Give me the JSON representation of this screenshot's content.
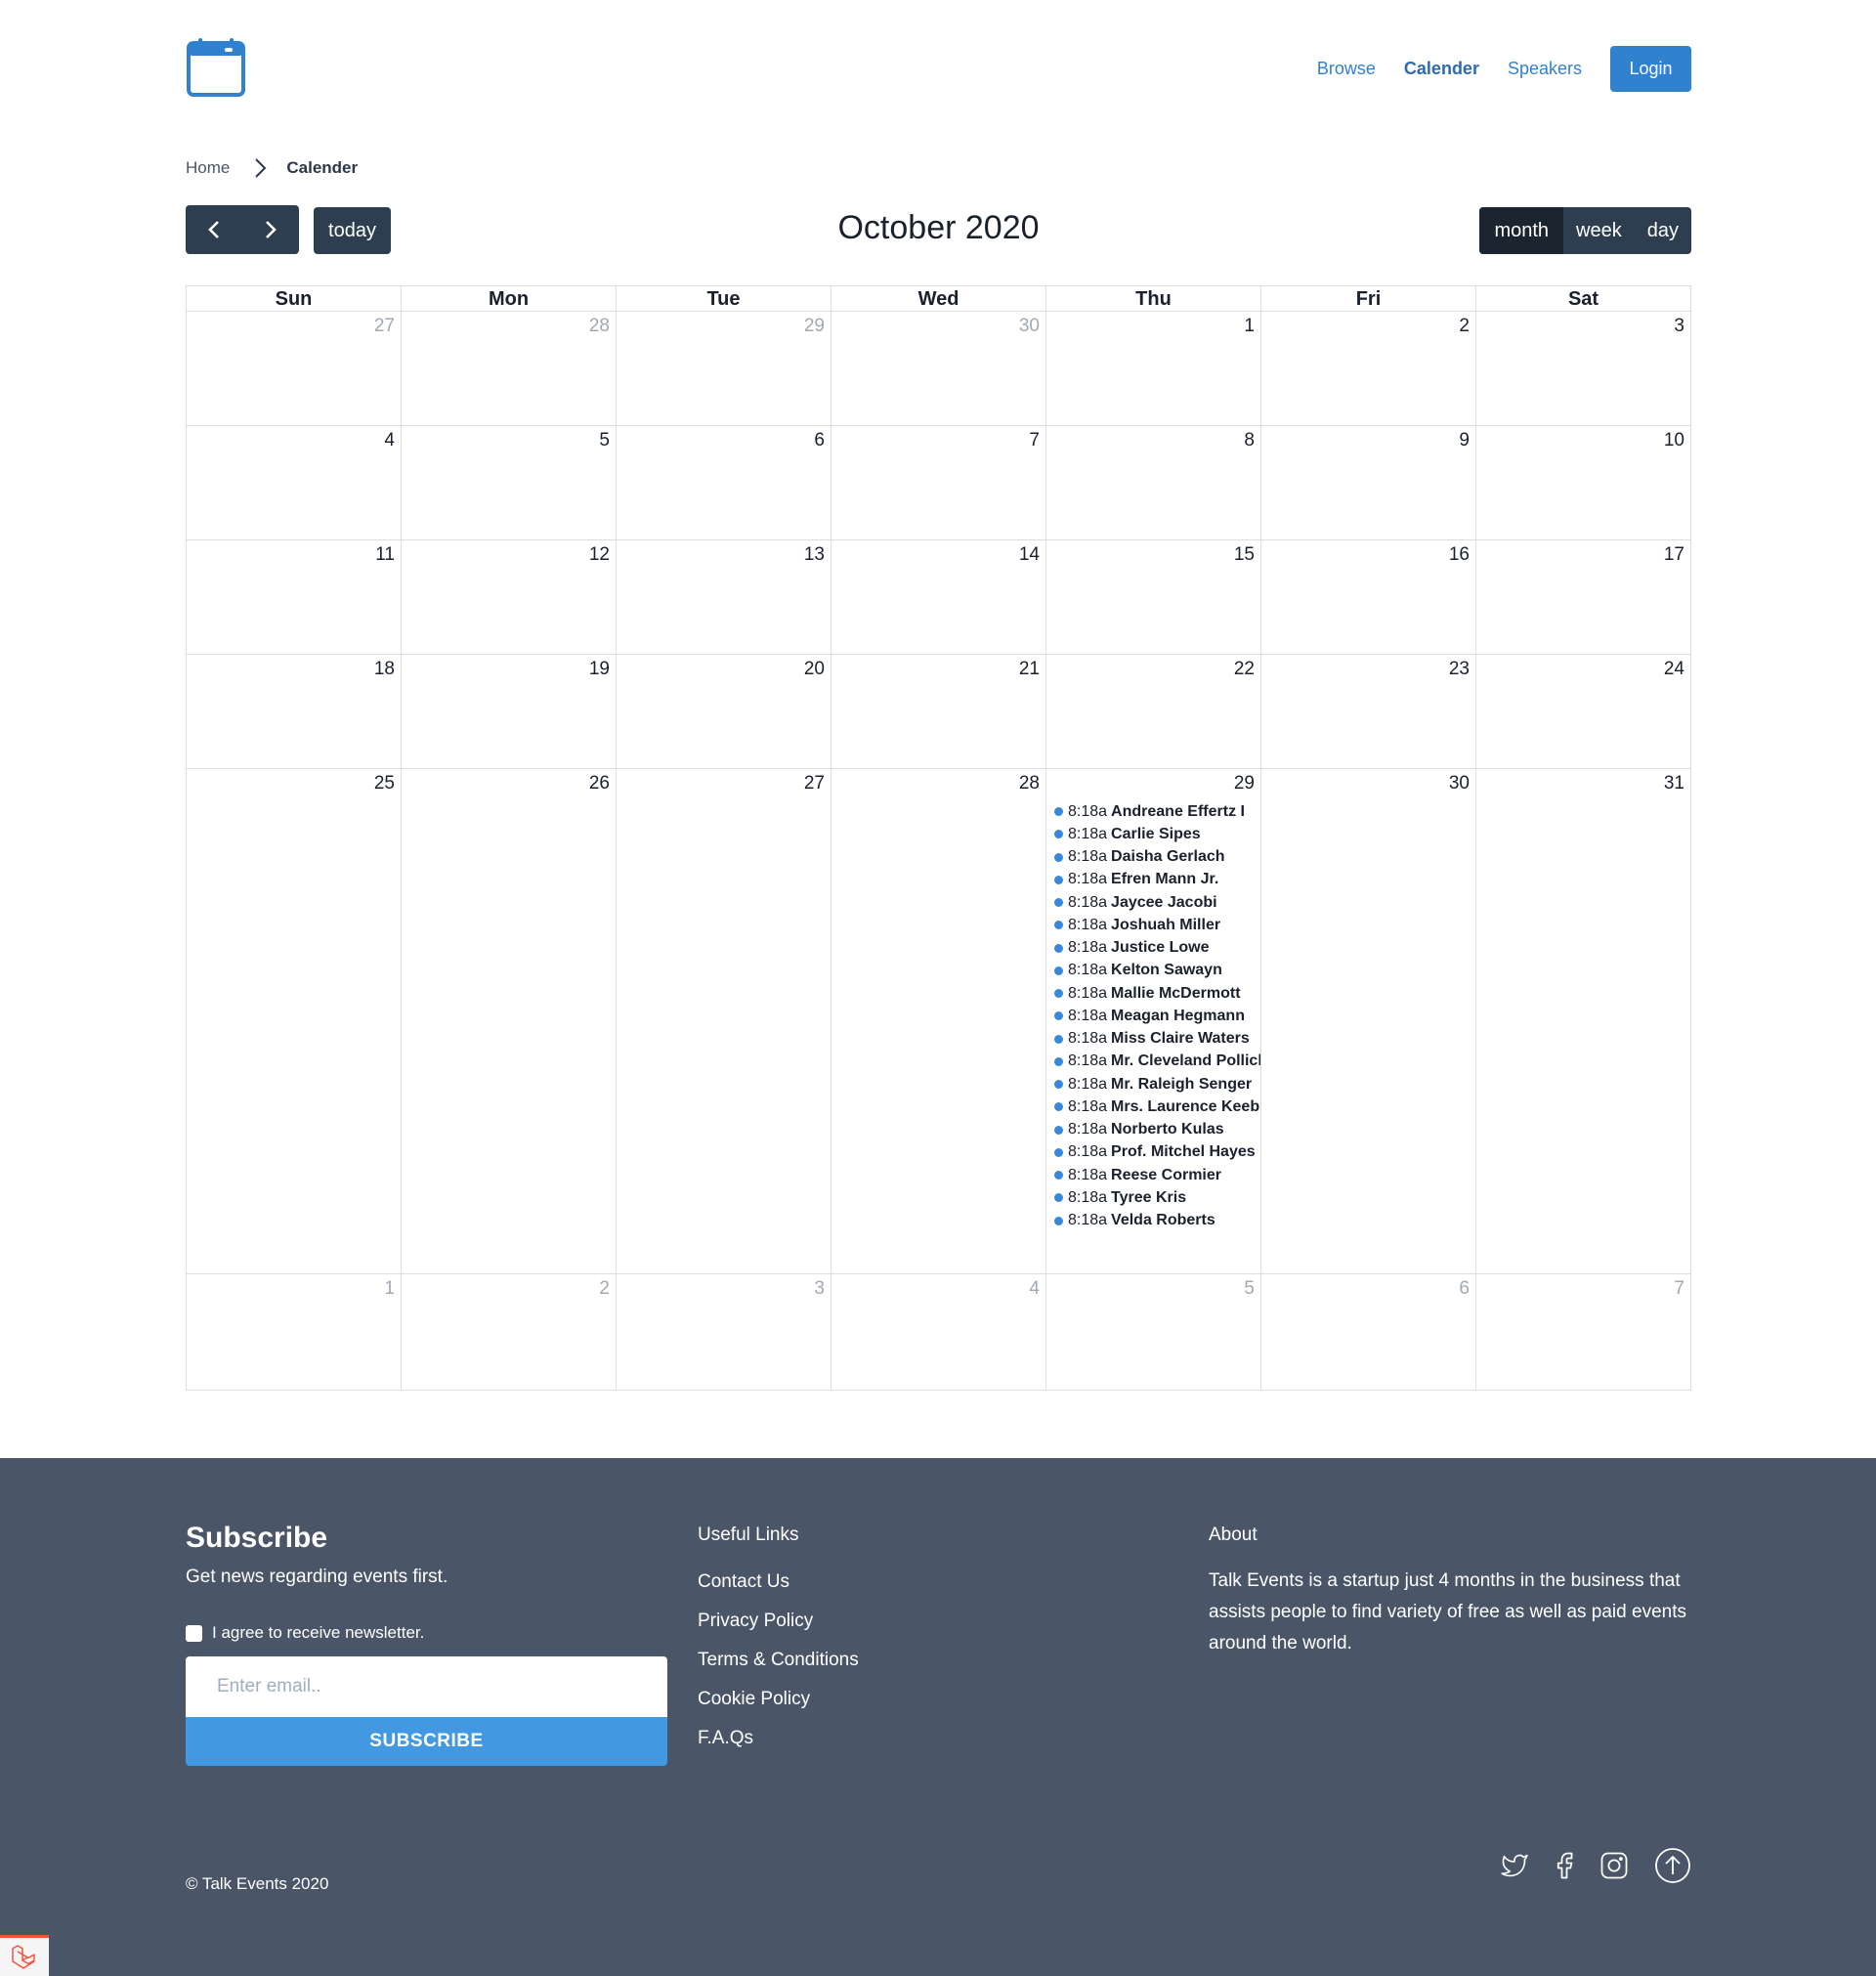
{
  "brand": {
    "accent": "#3182ce",
    "dark_button": "#2c3e50",
    "event_dot": "#3788d8",
    "footer_bg": "#4a5568"
  },
  "nav": {
    "items": [
      {
        "label": "Browse",
        "active": false
      },
      {
        "label": "Calender",
        "active": true
      },
      {
        "label": "Speakers",
        "active": false
      }
    ],
    "login_label": "Login"
  },
  "breadcrumb": {
    "home": "Home",
    "current": "Calender"
  },
  "toolbar": {
    "today_label": "today",
    "title": "October 2020",
    "views": [
      {
        "label": "month",
        "active": true
      },
      {
        "label": "week",
        "active": false
      },
      {
        "label": "day",
        "active": false
      }
    ]
  },
  "calendar": {
    "weekdays": [
      "Sun",
      "Mon",
      "Tue",
      "Wed",
      "Thu",
      "Fri",
      "Sat"
    ],
    "weeks": [
      [
        {
          "d": "27",
          "other": true
        },
        {
          "d": "28",
          "other": true
        },
        {
          "d": "29",
          "other": true
        },
        {
          "d": "30",
          "other": true
        },
        {
          "d": "1"
        },
        {
          "d": "2"
        },
        {
          "d": "3"
        }
      ],
      [
        {
          "d": "4"
        },
        {
          "d": "5"
        },
        {
          "d": "6"
        },
        {
          "d": "7"
        },
        {
          "d": "8"
        },
        {
          "d": "9"
        },
        {
          "d": "10"
        }
      ],
      [
        {
          "d": "11"
        },
        {
          "d": "12"
        },
        {
          "d": "13"
        },
        {
          "d": "14"
        },
        {
          "d": "15"
        },
        {
          "d": "16"
        },
        {
          "d": "17"
        }
      ],
      [
        {
          "d": "18"
        },
        {
          "d": "19"
        },
        {
          "d": "20"
        },
        {
          "d": "21"
        },
        {
          "d": "22"
        },
        {
          "d": "23"
        },
        {
          "d": "24"
        }
      ],
      [
        {
          "d": "25"
        },
        {
          "d": "26"
        },
        {
          "d": "27"
        },
        {
          "d": "28"
        },
        {
          "d": "29",
          "events": [
            {
              "time": "8:18a",
              "title": "Andreane Effertz I"
            },
            {
              "time": "8:18a",
              "title": "Carlie Sipes"
            },
            {
              "time": "8:18a",
              "title": "Daisha Gerlach"
            },
            {
              "time": "8:18a",
              "title": "Efren Mann Jr."
            },
            {
              "time": "8:18a",
              "title": "Jaycee Jacobi"
            },
            {
              "time": "8:18a",
              "title": "Joshuah Miller"
            },
            {
              "time": "8:18a",
              "title": "Justice Lowe"
            },
            {
              "time": "8:18a",
              "title": "Kelton Sawayn"
            },
            {
              "time": "8:18a",
              "title": "Mallie McDermott"
            },
            {
              "time": "8:18a",
              "title": "Meagan Hegmann"
            },
            {
              "time": "8:18a",
              "title": "Miss Claire Waters"
            },
            {
              "time": "8:18a",
              "title": "Mr. Cleveland Pollich"
            },
            {
              "time": "8:18a",
              "title": "Mr. Raleigh Senger"
            },
            {
              "time": "8:18a",
              "title": "Mrs. Laurence Keebler"
            },
            {
              "time": "8:18a",
              "title": "Norberto Kulas"
            },
            {
              "time": "8:18a",
              "title": "Prof. Mitchel Hayes"
            },
            {
              "time": "8:18a",
              "title": "Reese Cormier"
            },
            {
              "time": "8:18a",
              "title": "Tyree Kris"
            },
            {
              "time": "8:18a",
              "title": "Velda Roberts"
            }
          ]
        },
        {
          "d": "30"
        },
        {
          "d": "31"
        }
      ],
      [
        {
          "d": "1",
          "other": true
        },
        {
          "d": "2",
          "other": true
        },
        {
          "d": "3",
          "other": true
        },
        {
          "d": "4",
          "other": true
        },
        {
          "d": "5",
          "other": true
        },
        {
          "d": "6",
          "other": true
        },
        {
          "d": "7",
          "other": true
        }
      ]
    ]
  },
  "footer": {
    "subscribe": {
      "title": "Subscribe",
      "text": "Get news regarding events first.",
      "agree_label": "I agree to receive newsletter.",
      "email_placeholder": "Enter email..",
      "button_label": "SUBSCRIBE"
    },
    "useful_links": {
      "heading": "Useful Links",
      "items": [
        "Contact Us",
        "Privacy Policy",
        "Terms & Conditions",
        "Cookie Policy",
        "F.A.Qs"
      ]
    },
    "about": {
      "heading": "About",
      "text": "Talk Events is a startup just 4 months in the business that assists people to find variety of free as well as paid events around the world."
    },
    "copyright": "© Talk Events 2020",
    "socials": [
      "twitter-icon",
      "facebook-icon",
      "instagram-icon",
      "scroll-top-icon"
    ]
  }
}
